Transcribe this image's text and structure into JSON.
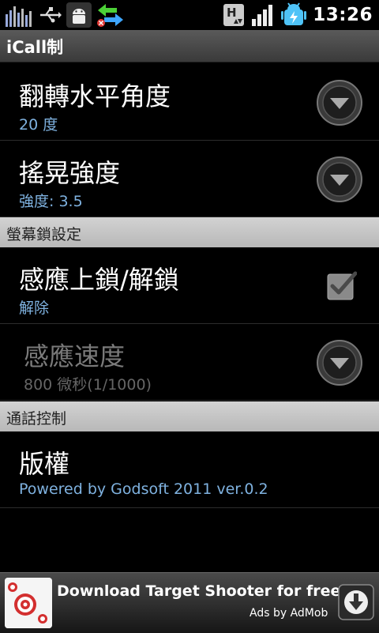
{
  "status_bar": {
    "time": "13:26",
    "icons_left": [
      "equalizer-icon",
      "usb-icon",
      "android-debug-icon",
      "sync-arrows-icon"
    ],
    "icons_right": [
      "h-network-icon",
      "signal-icon",
      "battery-charging-icon"
    ]
  },
  "app": {
    "title": "iCall制"
  },
  "prefs_top": [
    {
      "title": "翻轉水平角度",
      "summary": "20 度",
      "control": "dropdown"
    },
    {
      "title": "搖晃強度",
      "summary": "強度: 3.5",
      "control": "dropdown"
    }
  ],
  "category_lock": {
    "label": "螢幕鎖設定"
  },
  "prefs_lock": [
    {
      "title": "感應上鎖/解鎖",
      "summary": "解除",
      "control": "checkbox",
      "checked": true
    },
    {
      "title": "感應速度",
      "summary": "800 微秒(1/1000)",
      "control": "dropdown",
      "enabled": false
    }
  ],
  "category_call": {
    "label": "通話控制"
  },
  "prefs_call": [
    {
      "title": "版權",
      "summary": "Powered by Godsoft 2011 ver.0.2"
    }
  ],
  "ad": {
    "title": "Download Target Shooter for free!",
    "subtitle": "Ads by AdMob"
  },
  "colors": {
    "summary": "#7fb2e0",
    "category_bg": "#c4c4c4",
    "status_green": "#4fc3f7"
  }
}
